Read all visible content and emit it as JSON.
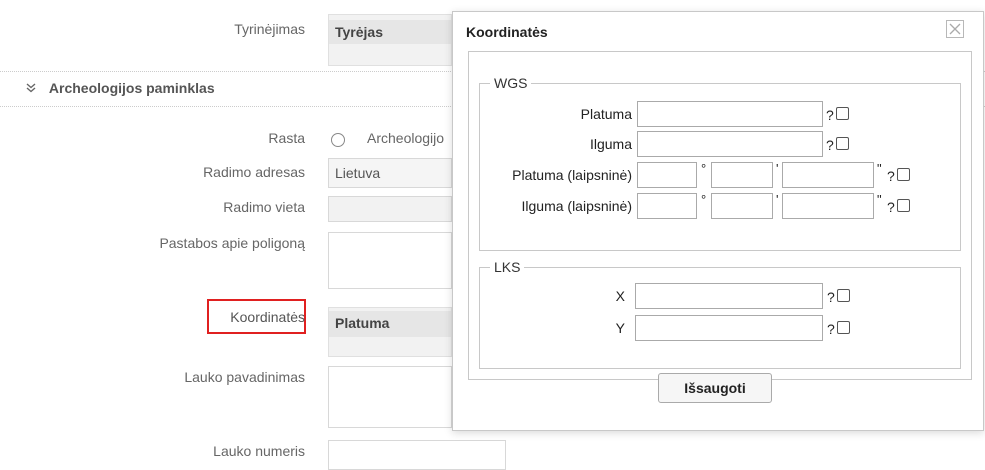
{
  "form": {
    "tyrinejimas_label": "Tyrinėjimas",
    "tyrejas_header": "Tyrėjas",
    "section_title": "Archeologijos paminklas",
    "rasta_label": "Rasta",
    "rasta_option": "Archeologijo",
    "radimo_adresas_label": "Radimo adresas",
    "radimo_adresas_value": "Lietuva",
    "radimo_vieta_label": "Radimo vieta",
    "pastabos_label": "Pastabos apie poligoną",
    "koordinates_label": "Koordinatės",
    "platuma_header": "Platuma",
    "lauko_pavadinimas_label": "Lauko pavadinimas",
    "lauko_numeris_label": "Lauko numeris"
  },
  "dialog": {
    "title": "Koordinatės",
    "wgs": {
      "legend": "WGS",
      "platuma_label": "Platuma",
      "ilguma_label": "Ilguma",
      "platuma_dms_label": "Platuma (laipsninė)",
      "ilguma_dms_label": "Ilguma (laipsninė)",
      "degree_symbol": "°",
      "minute_symbol": "'",
      "second_symbol": "\"",
      "help_mark": "?"
    },
    "lks": {
      "legend": "LKS",
      "x_label": "X",
      "y_label": "Y",
      "help_mark": "?"
    },
    "save_label": "Išsaugoti"
  }
}
